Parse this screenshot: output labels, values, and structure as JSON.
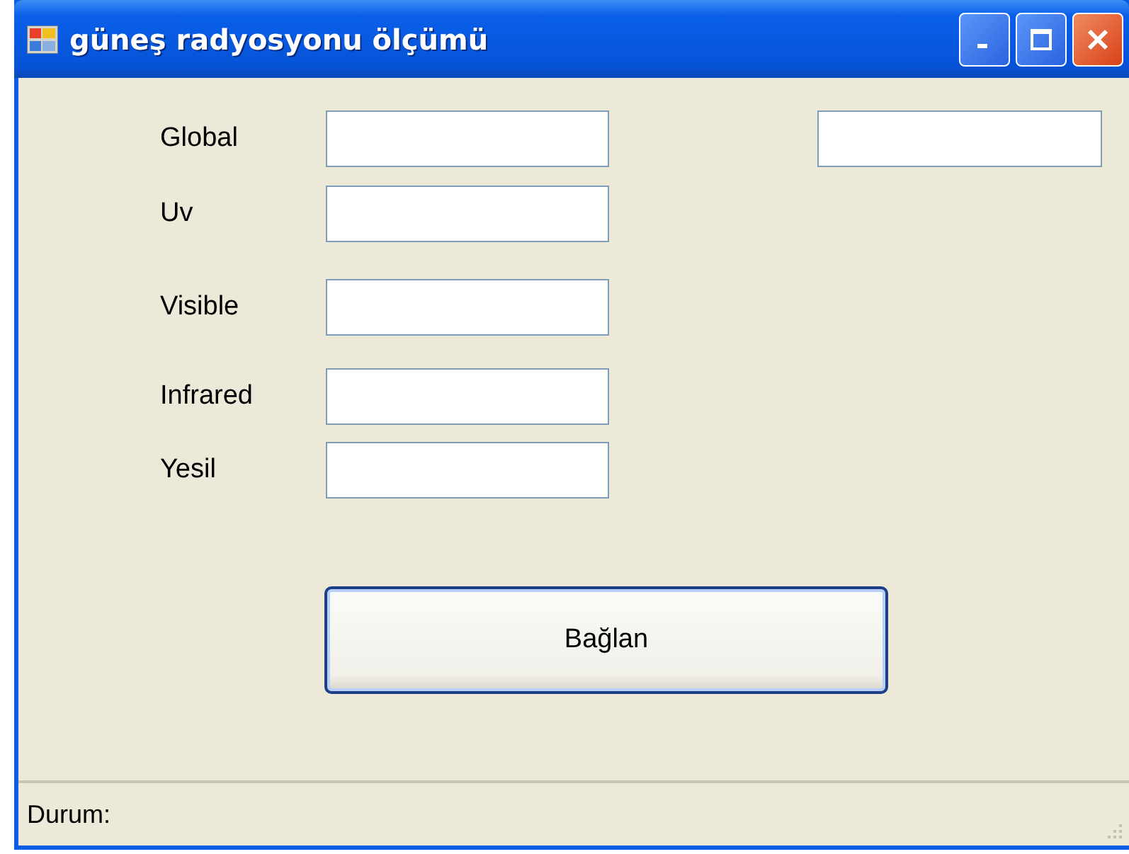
{
  "window": {
    "title": "güneş radyosyonu ölçümü"
  },
  "fields": [
    {
      "label": "Global"
    },
    {
      "label": "Uv"
    },
    {
      "label": "Visible"
    },
    {
      "label": "Infrared"
    },
    {
      "label": "Yesil"
    }
  ],
  "button": {
    "label": "Bağlan"
  },
  "status_bar": {
    "text": "Durum:"
  }
}
